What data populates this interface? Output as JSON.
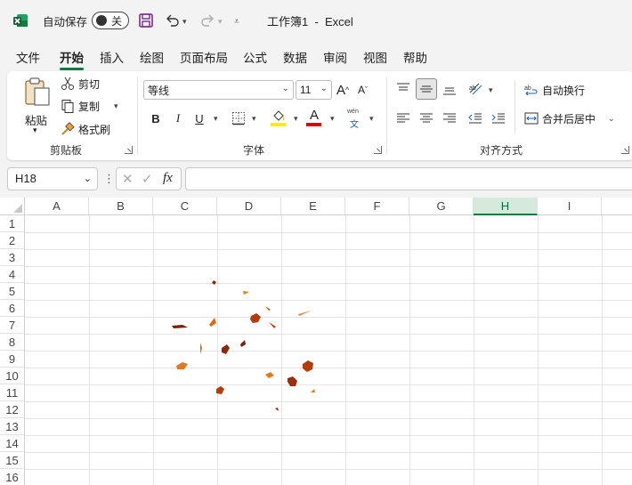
{
  "titlebar": {
    "autosave_label": "自动保存",
    "autosave_state": "关",
    "document_title": "工作簿1  -  Excel"
  },
  "tabs": [
    "文件",
    "开始",
    "插入",
    "绘图",
    "页面布局",
    "公式",
    "数据",
    "审阅",
    "视图",
    "帮助"
  ],
  "active_tab": "开始",
  "ribbon": {
    "clipboard": {
      "paste": "粘贴",
      "cut": "剪切",
      "copy": "复制",
      "format_painter": "格式刷",
      "group_label": "剪贴板"
    },
    "font": {
      "font_name": "等线",
      "font_size": "11",
      "bold": "B",
      "italic": "I",
      "underline": "U",
      "font_color_letter": "A",
      "phonetic_top": "wén",
      "phonetic_bottom": "文",
      "group_label": "字体",
      "fill_color": "#ffff00",
      "font_color": "#e00000"
    },
    "alignment": {
      "wrap_text": "自动换行",
      "merge_center": "合并后居中",
      "group_label": "对齐方式"
    }
  },
  "formula_bar": {
    "name_box": "H18",
    "fx_label": "fx",
    "formula": ""
  },
  "sheet": {
    "columns": [
      "A",
      "B",
      "C",
      "D",
      "E",
      "F",
      "G",
      "H",
      "I"
    ],
    "selected_column": "H",
    "rows": [
      "1",
      "2",
      "3",
      "4",
      "5",
      "6",
      "7",
      "8",
      "9",
      "10",
      "11",
      "12",
      "13",
      "14",
      "15",
      "16"
    ]
  },
  "colors": {
    "accent": "#117a43",
    "leaf_dark": "#8b2a0a",
    "leaf_light": "#e07a1c"
  }
}
